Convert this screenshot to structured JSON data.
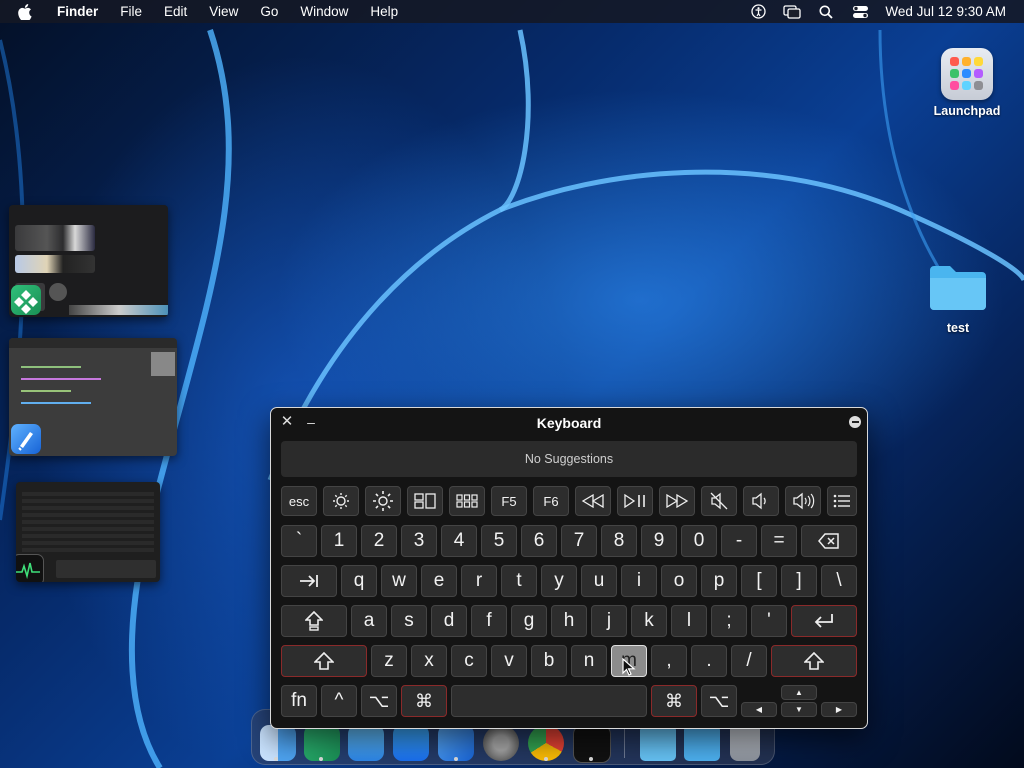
{
  "menubar": {
    "apple_icon": "apple-logo-icon",
    "app_name": "Finder",
    "menus": [
      "File",
      "Edit",
      "View",
      "Go",
      "Window",
      "Help"
    ],
    "status_icons": [
      "accessibility-icon",
      "screen-mirroring-icon",
      "spotlight-search-icon",
      "control-center-icon"
    ],
    "clock": "Wed Jul 12  9:30 AM"
  },
  "desktop": {
    "items": [
      {
        "label": "Launchpad",
        "icon": "launchpad-icon"
      },
      {
        "label": "test",
        "icon": "folder-icon"
      }
    ]
  },
  "stage_manager": {
    "thumbnails": [
      "Launchpad window",
      "Xcode window",
      "Activity Monitor window"
    ]
  },
  "keyboard_viewer": {
    "title": "Keyboard",
    "suggestions_text": "No Suggestions",
    "function_row": [
      "esc",
      "brightness-down-icon",
      "brightness-up-icon",
      "mission-control-icon",
      "launchpad-icon",
      "F5",
      "F6",
      "rewind-icon",
      "play-pause-icon",
      "fast-forward-icon",
      "mute-icon",
      "volume-down-icon",
      "volume-up-icon",
      "list-icon"
    ],
    "row_numbers": [
      "`",
      "1",
      "2",
      "3",
      "4",
      "5",
      "6",
      "7",
      "8",
      "9",
      "0",
      "-",
      "="
    ],
    "row_q": [
      "q",
      "w",
      "e",
      "r",
      "t",
      "y",
      "u",
      "i",
      "o",
      "p",
      "[",
      "]",
      "\\"
    ],
    "row_a": [
      "a",
      "s",
      "d",
      "f",
      "g",
      "h",
      "j",
      "k",
      "l",
      ";",
      "'"
    ],
    "row_z": [
      "z",
      "x",
      "c",
      "v",
      "b",
      "n",
      "m",
      ",",
      ".",
      "/"
    ],
    "row_bottom": {
      "fn": "fn",
      "control": "^",
      "option": "⌥",
      "command": "⌘"
    },
    "pressed_key": "m",
    "accent_color": "#8a2a2a"
  },
  "dock": {
    "apps": [
      "Finder",
      "Xcode-like app",
      "Mail",
      "App Store",
      "Xcode",
      "System Settings",
      "Chrome",
      "Activity Monitor",
      "Folder",
      "Downloads",
      "Trash"
    ]
  }
}
